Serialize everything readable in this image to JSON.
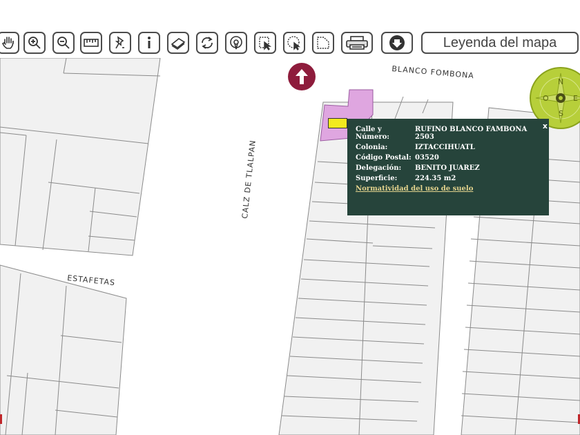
{
  "toolbar": {
    "tools": [
      {
        "name": "pan-tool",
        "icon": "hand-icon"
      },
      {
        "name": "zoom-in-tool",
        "icon": "zoom-in-icon"
      },
      {
        "name": "zoom-out-tool",
        "icon": "zoom-out-icon"
      },
      {
        "name": "measure-tool",
        "icon": "ruler-icon"
      },
      {
        "name": "pin-tool",
        "icon": "pin-icon"
      },
      {
        "name": "info-tool",
        "icon": "info-icon"
      },
      {
        "name": "layers-tool",
        "icon": "layers-icon"
      },
      {
        "name": "refresh-tool",
        "icon": "refresh-icon"
      },
      {
        "name": "locate-tool",
        "icon": "locate-icon"
      },
      {
        "name": "select-point-tool",
        "icon": "select-point-icon"
      },
      {
        "name": "select-circle-tool",
        "icon": "select-circle-icon"
      },
      {
        "name": "select-polygon-tool",
        "icon": "select-polygon-icon"
      },
      {
        "name": "print-tool",
        "icon": "printer-icon"
      },
      {
        "name": "download-tool",
        "icon": "download-icon"
      }
    ],
    "legend_label": "Leyenda del mapa"
  },
  "streets": {
    "blanco_fombona": "BLANCO FOMBONA",
    "calz_tlalpan": "CALZ DE TLALPAN",
    "estafetas": "ESTAFETAS"
  },
  "compass": {
    "north": "N",
    "south": "S",
    "east": "E",
    "west": "O"
  },
  "popup": {
    "rows": [
      {
        "label": "Calle y Número:",
        "value": "RUFINO BLANCO FAMBONA 2503"
      },
      {
        "label": "Colonia:",
        "value": "IZTACCIHUATL"
      },
      {
        "label": "Código Postal:",
        "value": "03520"
      },
      {
        "label": "Delegación:",
        "value": "BENITO JUAREZ"
      },
      {
        "label": "Superficie:",
        "value": "224.35 m2"
      }
    ],
    "link": "Normatividad del uso de suelo",
    "close": "x"
  },
  "colors": {
    "popup_bg": "#26443b",
    "parcel_highlight": "#dfa6e0",
    "marker": "#f3ea1e",
    "north_button": "#8e1c3c",
    "compass": "#b7cf3a",
    "block_fill": "#f1f1f1",
    "block_stroke": "#8a8a8a"
  }
}
